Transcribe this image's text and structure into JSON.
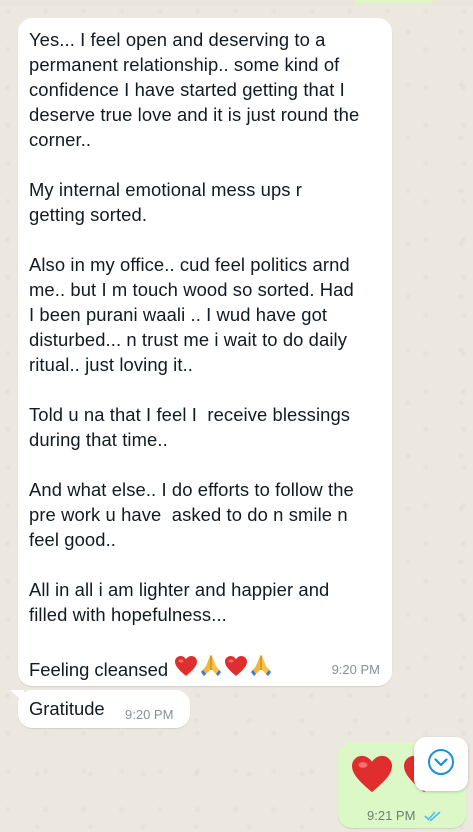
{
  "chat": {
    "messages": [
      {
        "direction": "incoming",
        "text": "Yes... I feel open and deserving to a\npermanent relationship.. some kind of\nconfidence I have started getting that I\ndeserve true love and it is just round the\ncorner..\n\nMy internal emotional mess ups r\ngetting sorted.\n\nAlso in my office.. cud feel politics arnd\nme.. but I m touch wood so sorted. Had\nI been purani waali .. I wud have got\ndisturbed... n trust me i wait to do daily\nritual.. just loving it..\n\nTold u na that I feel I  receive blessings\nduring that time..\n\nAnd what else.. I do efforts to follow the\npre work u have  asked to do n smile n\nfeel good..\n\nAll in all i am lighter and happier and\nfilled with hopefulness...",
        "last_line": "Feeling cleansed",
        "emojis": [
          "red-heart",
          "folded-hands",
          "red-heart",
          "folded-hands"
        ],
        "time": "9:20 PM"
      },
      {
        "direction": "incoming",
        "text": "Gratitude",
        "time": "9:20 PM"
      },
      {
        "direction": "outgoing",
        "emojis": [
          "red-heart",
          "red-heart"
        ],
        "time": "9:21 PM",
        "status": "read"
      }
    ],
    "colors": {
      "incoming_bubble": "#ffffff",
      "outgoing_bubble": "#dcf8c6",
      "background": "#efeae2",
      "read_ticks": "#53bdeb",
      "heart": "#e02d2d"
    },
    "icons": {
      "scroll_down": "chevron-down-circle-icon"
    }
  }
}
